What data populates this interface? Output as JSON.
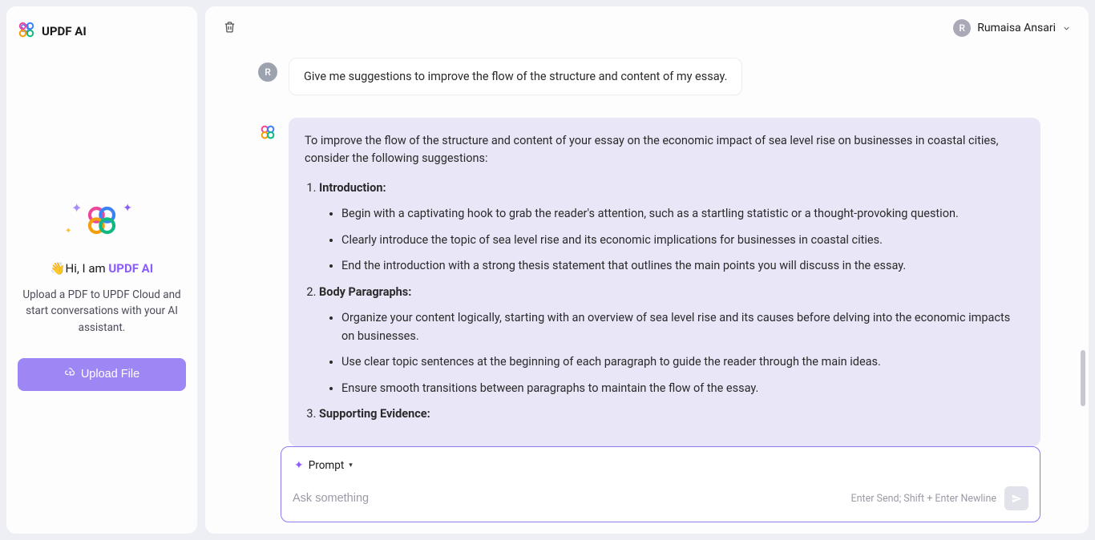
{
  "sidebar": {
    "title": "UPDF AI",
    "greeting_prefix": "👋Hi, I am ",
    "greeting_brand": "UPDF AI",
    "description": "Upload a PDF to UPDF Cloud and start conversations with your AI assistant.",
    "upload_label": "Upload File"
  },
  "header": {
    "user_initial": "R",
    "user_name": "Rumaisa Ansari"
  },
  "chat": {
    "user_initial": "R",
    "user_message": "Give me suggestions to improve the flow of the structure and content of my essay.",
    "ai_intro": "To improve the flow of the structure and content of your essay on the economic impact of sea level rise on businesses in coastal cities, consider the following suggestions:",
    "sections": [
      {
        "title": "Introduction:",
        "bullets": [
          "Begin with a captivating hook to grab the reader's attention, such as a startling statistic or a thought-provoking question.",
          "Clearly introduce the topic of sea level rise and its economic implications for businesses in coastal cities.",
          "End the introduction with a strong thesis statement that outlines the main points you will discuss in the essay."
        ]
      },
      {
        "title": "Body Paragraphs:",
        "bullets": [
          "Organize your content logically, starting with an overview of sea level rise and its causes before delving into the economic impacts on businesses.",
          "Use clear topic sentences at the beginning of each paragraph to guide the reader through the main ideas.",
          "Ensure smooth transitions between paragraphs to maintain the flow of the essay."
        ]
      },
      {
        "title": "Supporting Evidence:",
        "bullets": []
      }
    ]
  },
  "composer": {
    "prompt_label": "Prompt",
    "placeholder": "Ask something",
    "hint": "Enter Send; Shift + Enter Newline"
  },
  "colors": {
    "accent": "#8b5cf6",
    "upload_bg": "#9e86f5",
    "ai_bubble": "#e9e7f7"
  }
}
